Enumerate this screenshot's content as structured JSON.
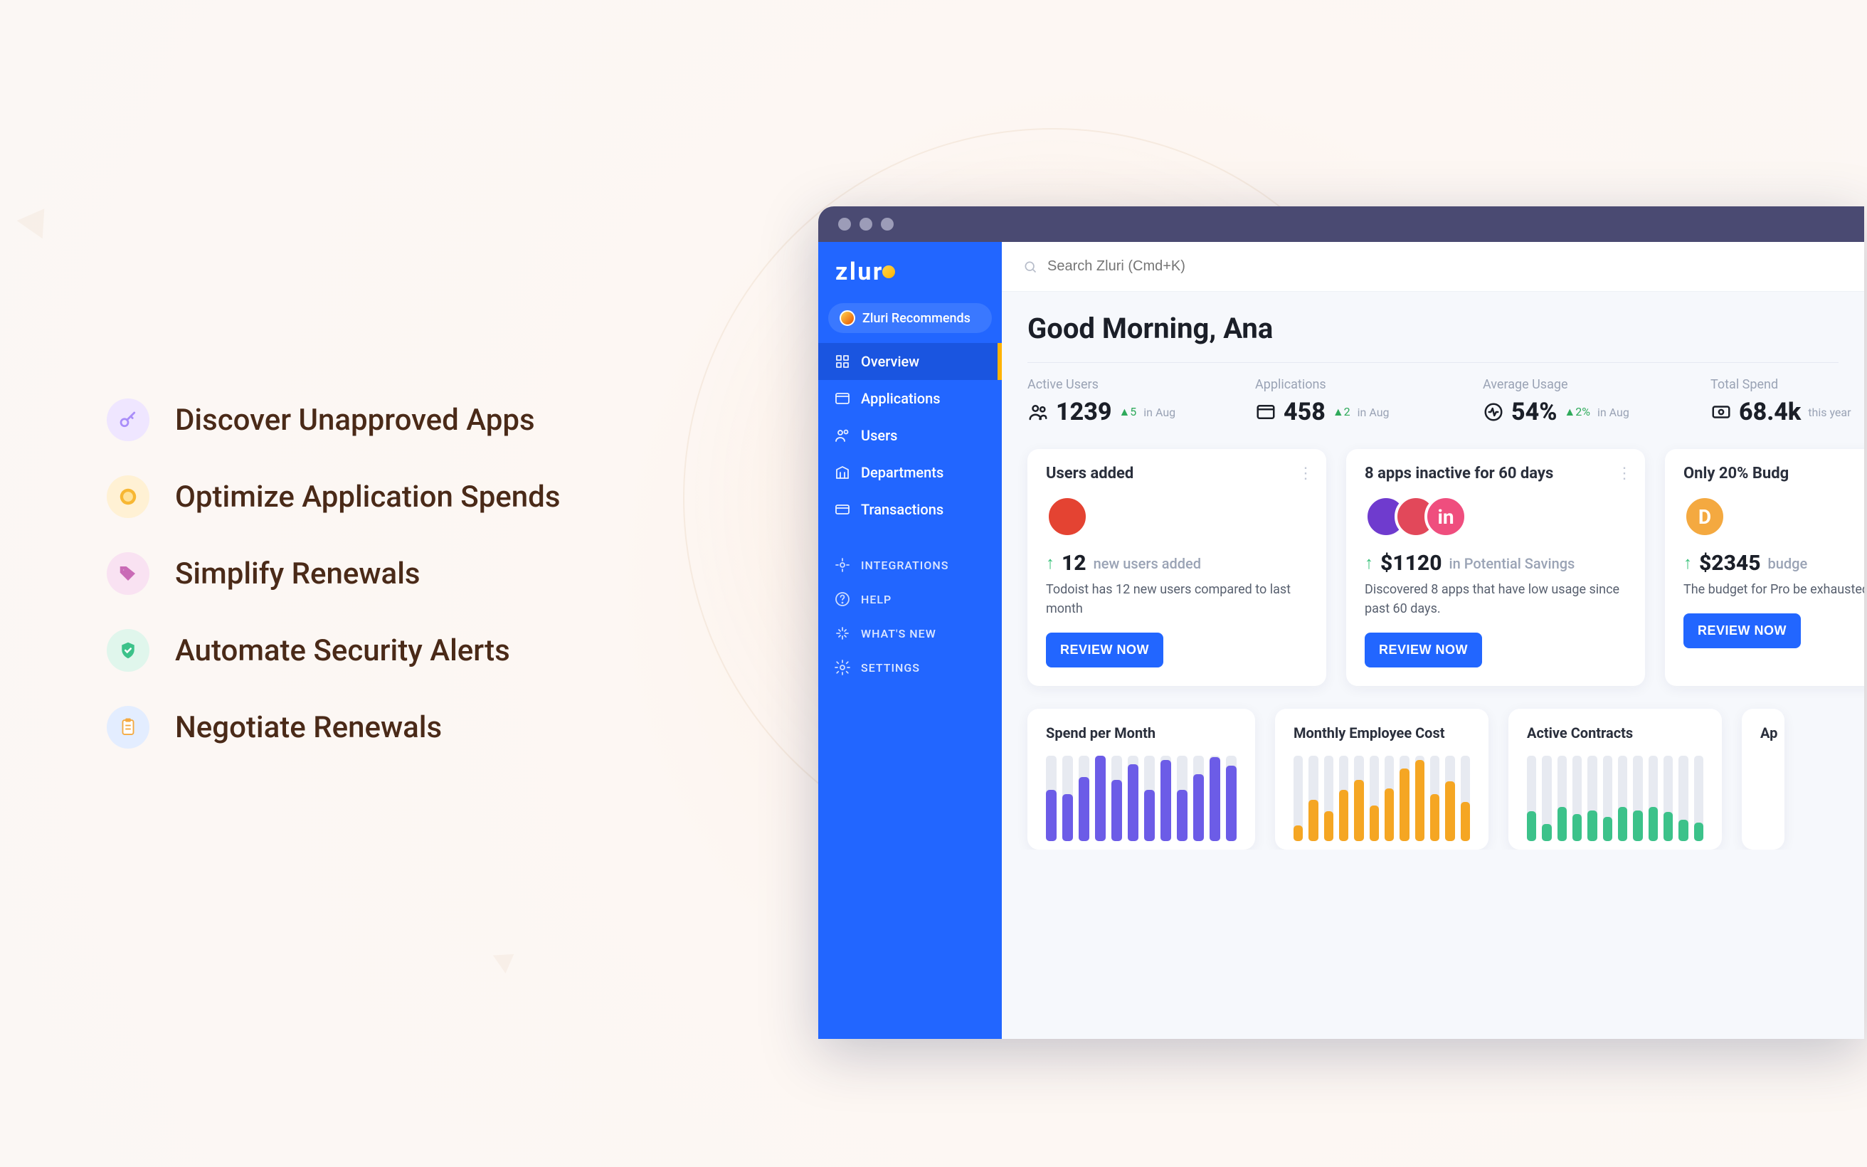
{
  "features": [
    {
      "label": "Discover Unapproved Apps",
      "icon": "key",
      "bg": "#efe6ff",
      "fg": "#a98df9"
    },
    {
      "label": "Optimize Application Spends",
      "icon": "coin",
      "bg": "#fff1d4",
      "fg": "#f7b733"
    },
    {
      "label": "Simplify Renewals",
      "icon": "tag",
      "bg": "#f9e2f2",
      "fg": "#c96bb6"
    },
    {
      "label": "Automate Security Alerts",
      "icon": "shield",
      "bg": "#e0f6ec",
      "fg": "#3cc28a"
    },
    {
      "label": "Negotiate Renewals",
      "icon": "clipboard",
      "bg": "#e3edff",
      "fg": "#f4a940"
    }
  ],
  "brand": {
    "name": "zluri"
  },
  "recommend": "Zluri Recommends",
  "nav": [
    {
      "label": "Overview",
      "icon": "grid",
      "active": true
    },
    {
      "label": "Applications",
      "icon": "window"
    },
    {
      "label": "Users",
      "icon": "users"
    },
    {
      "label": "Departments",
      "icon": "building"
    },
    {
      "label": "Transactions",
      "icon": "card"
    }
  ],
  "navSecondary": [
    {
      "label": "INTEGRATIONS",
      "icon": "plug"
    },
    {
      "label": "HELP",
      "icon": "help"
    },
    {
      "label": "WHAT'S NEW",
      "icon": "sparkle"
    },
    {
      "label": "SETTINGS",
      "icon": "gear"
    }
  ],
  "search": {
    "placeholder": "Search Zluri (Cmd+K)"
  },
  "greeting": "Good Morning, Ana",
  "kpis": [
    {
      "label": "Active Users",
      "value": "1239",
      "delta": "5",
      "period": "in Aug",
      "icon": "people"
    },
    {
      "label": "Applications",
      "value": "458",
      "delta": "2",
      "period": "in Aug",
      "icon": "apps"
    },
    {
      "label": "Average Usage",
      "value": "54%",
      "delta": "2%",
      "period": "in Aug",
      "icon": "pulse"
    },
    {
      "label": "Total Spend",
      "value": "68.4k",
      "delta": "",
      "period": "this year",
      "icon": "money"
    }
  ],
  "cards": [
    {
      "title": "Users added",
      "badges": [
        {
          "bg": "#e44332",
          "label": ""
        }
      ],
      "metric": "12",
      "metricSub": "new users added",
      "desc": "Todoist has 12 new users compared to last month",
      "action": "REVIEW NOW"
    },
    {
      "title": "8 apps inactive for 60 days",
      "badges": [
        {
          "bg": "#6f3bce"
        },
        {
          "bg": "#e2485a"
        },
        {
          "bg": "#ef4e7e",
          "label": "in"
        }
      ],
      "metric": "$1120",
      "metricSub": "in Potential Savings",
      "desc": "Discovered 8 apps that have low usage since past 60 days.",
      "action": "REVIEW NOW"
    },
    {
      "title": "Only 20% Budg",
      "badges": [
        {
          "bg": "#f4a940",
          "label": "D"
        }
      ],
      "metric": "$2345",
      "metricSub": "budge",
      "desc": "The budget for Pro be exhausted by N",
      "action": "REVIEW NOW"
    }
  ],
  "charts": [
    {
      "title": "Spend per Month",
      "color": "#6c5ce7",
      "values": [
        60,
        55,
        75,
        100,
        72,
        90,
        60,
        95,
        60,
        78,
        98,
        88
      ]
    },
    {
      "title": "Monthly Employee Cost",
      "color": "#f5a623",
      "values": [
        18,
        48,
        35,
        60,
        72,
        42,
        62,
        85,
        95,
        55,
        70,
        46
      ]
    },
    {
      "title": "Active Contracts",
      "color": "#3cc28a",
      "values": [
        35,
        20,
        40,
        32,
        36,
        28,
        40,
        36,
        40,
        34,
        25,
        22
      ]
    },
    {
      "title": "Ap",
      "color": "#888",
      "values": []
    }
  ]
}
